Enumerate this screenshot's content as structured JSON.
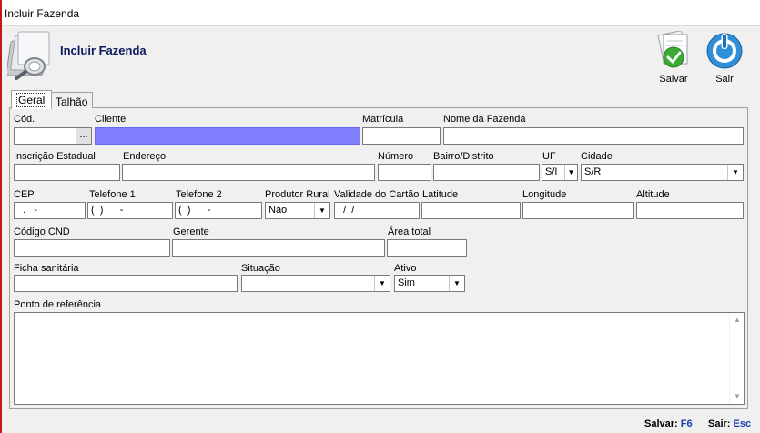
{
  "window": {
    "title": "Incluir Fazenda"
  },
  "header": {
    "title": "Incluir Fazenda"
  },
  "toolbar": {
    "save_label": "Salvar",
    "exit_label": "Sair",
    "save_icon": "check-icon",
    "exit_icon": "power-icon"
  },
  "tabs": [
    {
      "label": "Geral",
      "active": true
    },
    {
      "label": "Talhão",
      "active": false
    }
  ],
  "form": {
    "cod": {
      "label": "Cód.",
      "value": ""
    },
    "cod_lookup_label": "...",
    "cliente": {
      "label": "Cliente",
      "value": ""
    },
    "matricula": {
      "label": "Matrícula",
      "value": ""
    },
    "nome_fazenda": {
      "label": "Nome da Fazenda",
      "value": ""
    },
    "inscricao_estadual": {
      "label": "Inscrição Estadual",
      "value": ""
    },
    "endereco": {
      "label": "Endereço",
      "value": ""
    },
    "numero": {
      "label": "Número",
      "value": ""
    },
    "bairro": {
      "label": "Bairro/Distrito",
      "value": ""
    },
    "uf": {
      "label": "UF",
      "value": "S/I"
    },
    "cidade": {
      "label": "Cidade",
      "value": "S/R"
    },
    "cep": {
      "label": "CEP",
      "value": "  .   -"
    },
    "telefone1": {
      "label": "Telefone 1",
      "value": "(  )      -"
    },
    "telefone2": {
      "label": "Telefone 2",
      "value": "(  )      -"
    },
    "produtor_rural": {
      "label": "Produtor Rural",
      "value": "Não"
    },
    "validade_cartao": {
      "label": "Validade do Cartão",
      "value": "  /  /"
    },
    "latitude": {
      "label": "Latitude",
      "value": ""
    },
    "longitude": {
      "label": "Longitude",
      "value": ""
    },
    "altitude": {
      "label": "Altitude",
      "value": ""
    },
    "codigo_cnd": {
      "label": "Código CND",
      "value": ""
    },
    "gerente": {
      "label": "Gerente",
      "value": ""
    },
    "area_total": {
      "label": "Área total",
      "value": ""
    },
    "ficha_sanitaria": {
      "label": "Ficha sanitária",
      "value": ""
    },
    "situacao": {
      "label": "Situação",
      "value": ""
    },
    "ativo": {
      "label": "Ativo",
      "value": "Sim"
    },
    "ponto_referencia": {
      "label": "Ponto de referência",
      "value": ""
    }
  },
  "statusbar": {
    "save_text": "Salvar:",
    "save_key": "F6",
    "exit_text": "Sair:",
    "exit_key": "Esc"
  },
  "colors": {
    "highlight_field": "#8080ff",
    "title_blue": "#0b1a5c",
    "status_key": "#1a3fa8"
  }
}
